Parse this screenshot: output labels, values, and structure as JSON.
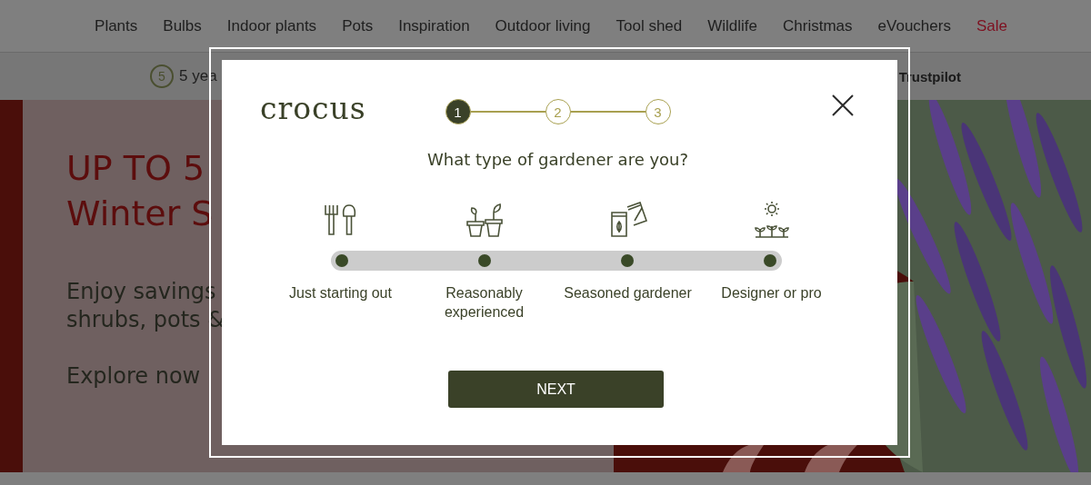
{
  "nav": {
    "items": [
      {
        "label": "Plants",
        "kind": "normal"
      },
      {
        "label": "Bulbs",
        "kind": "normal"
      },
      {
        "label": "Indoor plants",
        "kind": "normal"
      },
      {
        "label": "Pots",
        "kind": "normal"
      },
      {
        "label": "Inspiration",
        "kind": "normal"
      },
      {
        "label": "Outdoor living",
        "kind": "normal"
      },
      {
        "label": "Tool shed",
        "kind": "normal"
      },
      {
        "label": "Wildlife",
        "kind": "normal"
      },
      {
        "label": "Christmas",
        "kind": "normal"
      },
      {
        "label": "eVouchers",
        "kind": "normal"
      },
      {
        "label": "Sale",
        "kind": "sale"
      }
    ]
  },
  "info_bar": {
    "badge_number": "5",
    "left_text": "5 yea",
    "right_text": "Trustpilot"
  },
  "hero": {
    "title_lines": [
      "UP TO 5",
      "Winter S"
    ],
    "body_lines": [
      "Enjoy savings",
      "shrubs, pots &"
    ],
    "link": "Explore now"
  },
  "modal": {
    "logo": "crocus",
    "steps": [
      {
        "label": "1",
        "current": true
      },
      {
        "label": "2",
        "current": false
      },
      {
        "label": "3",
        "current": false
      }
    ],
    "question": "What type of gardener are you?",
    "options": [
      {
        "label": "Just starting out",
        "kind": "tools"
      },
      {
        "label": "Reasonably experienced",
        "kind": "pots"
      },
      {
        "label": "Seasoned gardener",
        "kind": "seeds"
      },
      {
        "label": "Designer or pro",
        "kind": "seedlings"
      }
    ],
    "button": "NEXT"
  }
}
